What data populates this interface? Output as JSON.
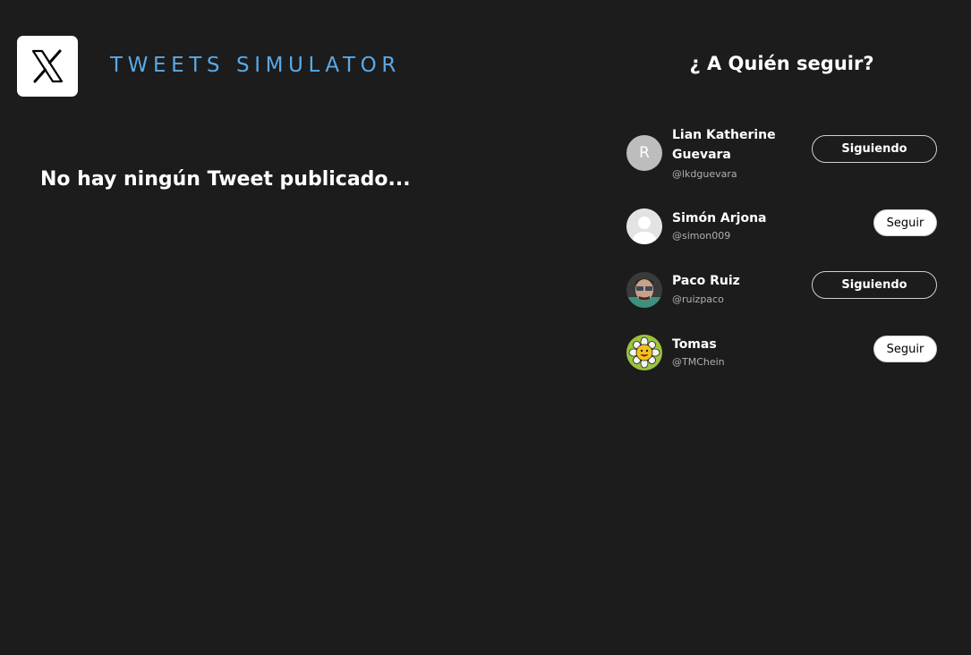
{
  "header": {
    "logo_icon": "x-logo-icon",
    "title": "TWEETS SIMULATOR",
    "title_color": "#5aa9e6"
  },
  "feed": {
    "empty_message": "No hay ningún Tweet publicado..."
  },
  "suggestions": {
    "heading": "¿ A Quién seguir?",
    "users": [
      {
        "name": "Lian Katherine Guevara",
        "handle": "@lkdguevara",
        "avatar": "initial",
        "initial": "R",
        "button_label": "Siguiendo",
        "following": true
      },
      {
        "name": "Simón Arjona",
        "handle": "@simon009",
        "avatar": "default-user-avatar",
        "button_label": "Seguir",
        "following": false
      },
      {
        "name": "Paco Ruiz",
        "handle": "@ruizpaco",
        "avatar": "photo-avatar",
        "button_label": "Siguiendo",
        "following": true
      },
      {
        "name": "Tomas",
        "handle": "@TMChein",
        "avatar": "sunflower-avatar",
        "button_label": "Seguir",
        "following": false
      }
    ]
  },
  "colors": {
    "background": "#1c1c1c",
    "accent": "#5aa9e6"
  }
}
